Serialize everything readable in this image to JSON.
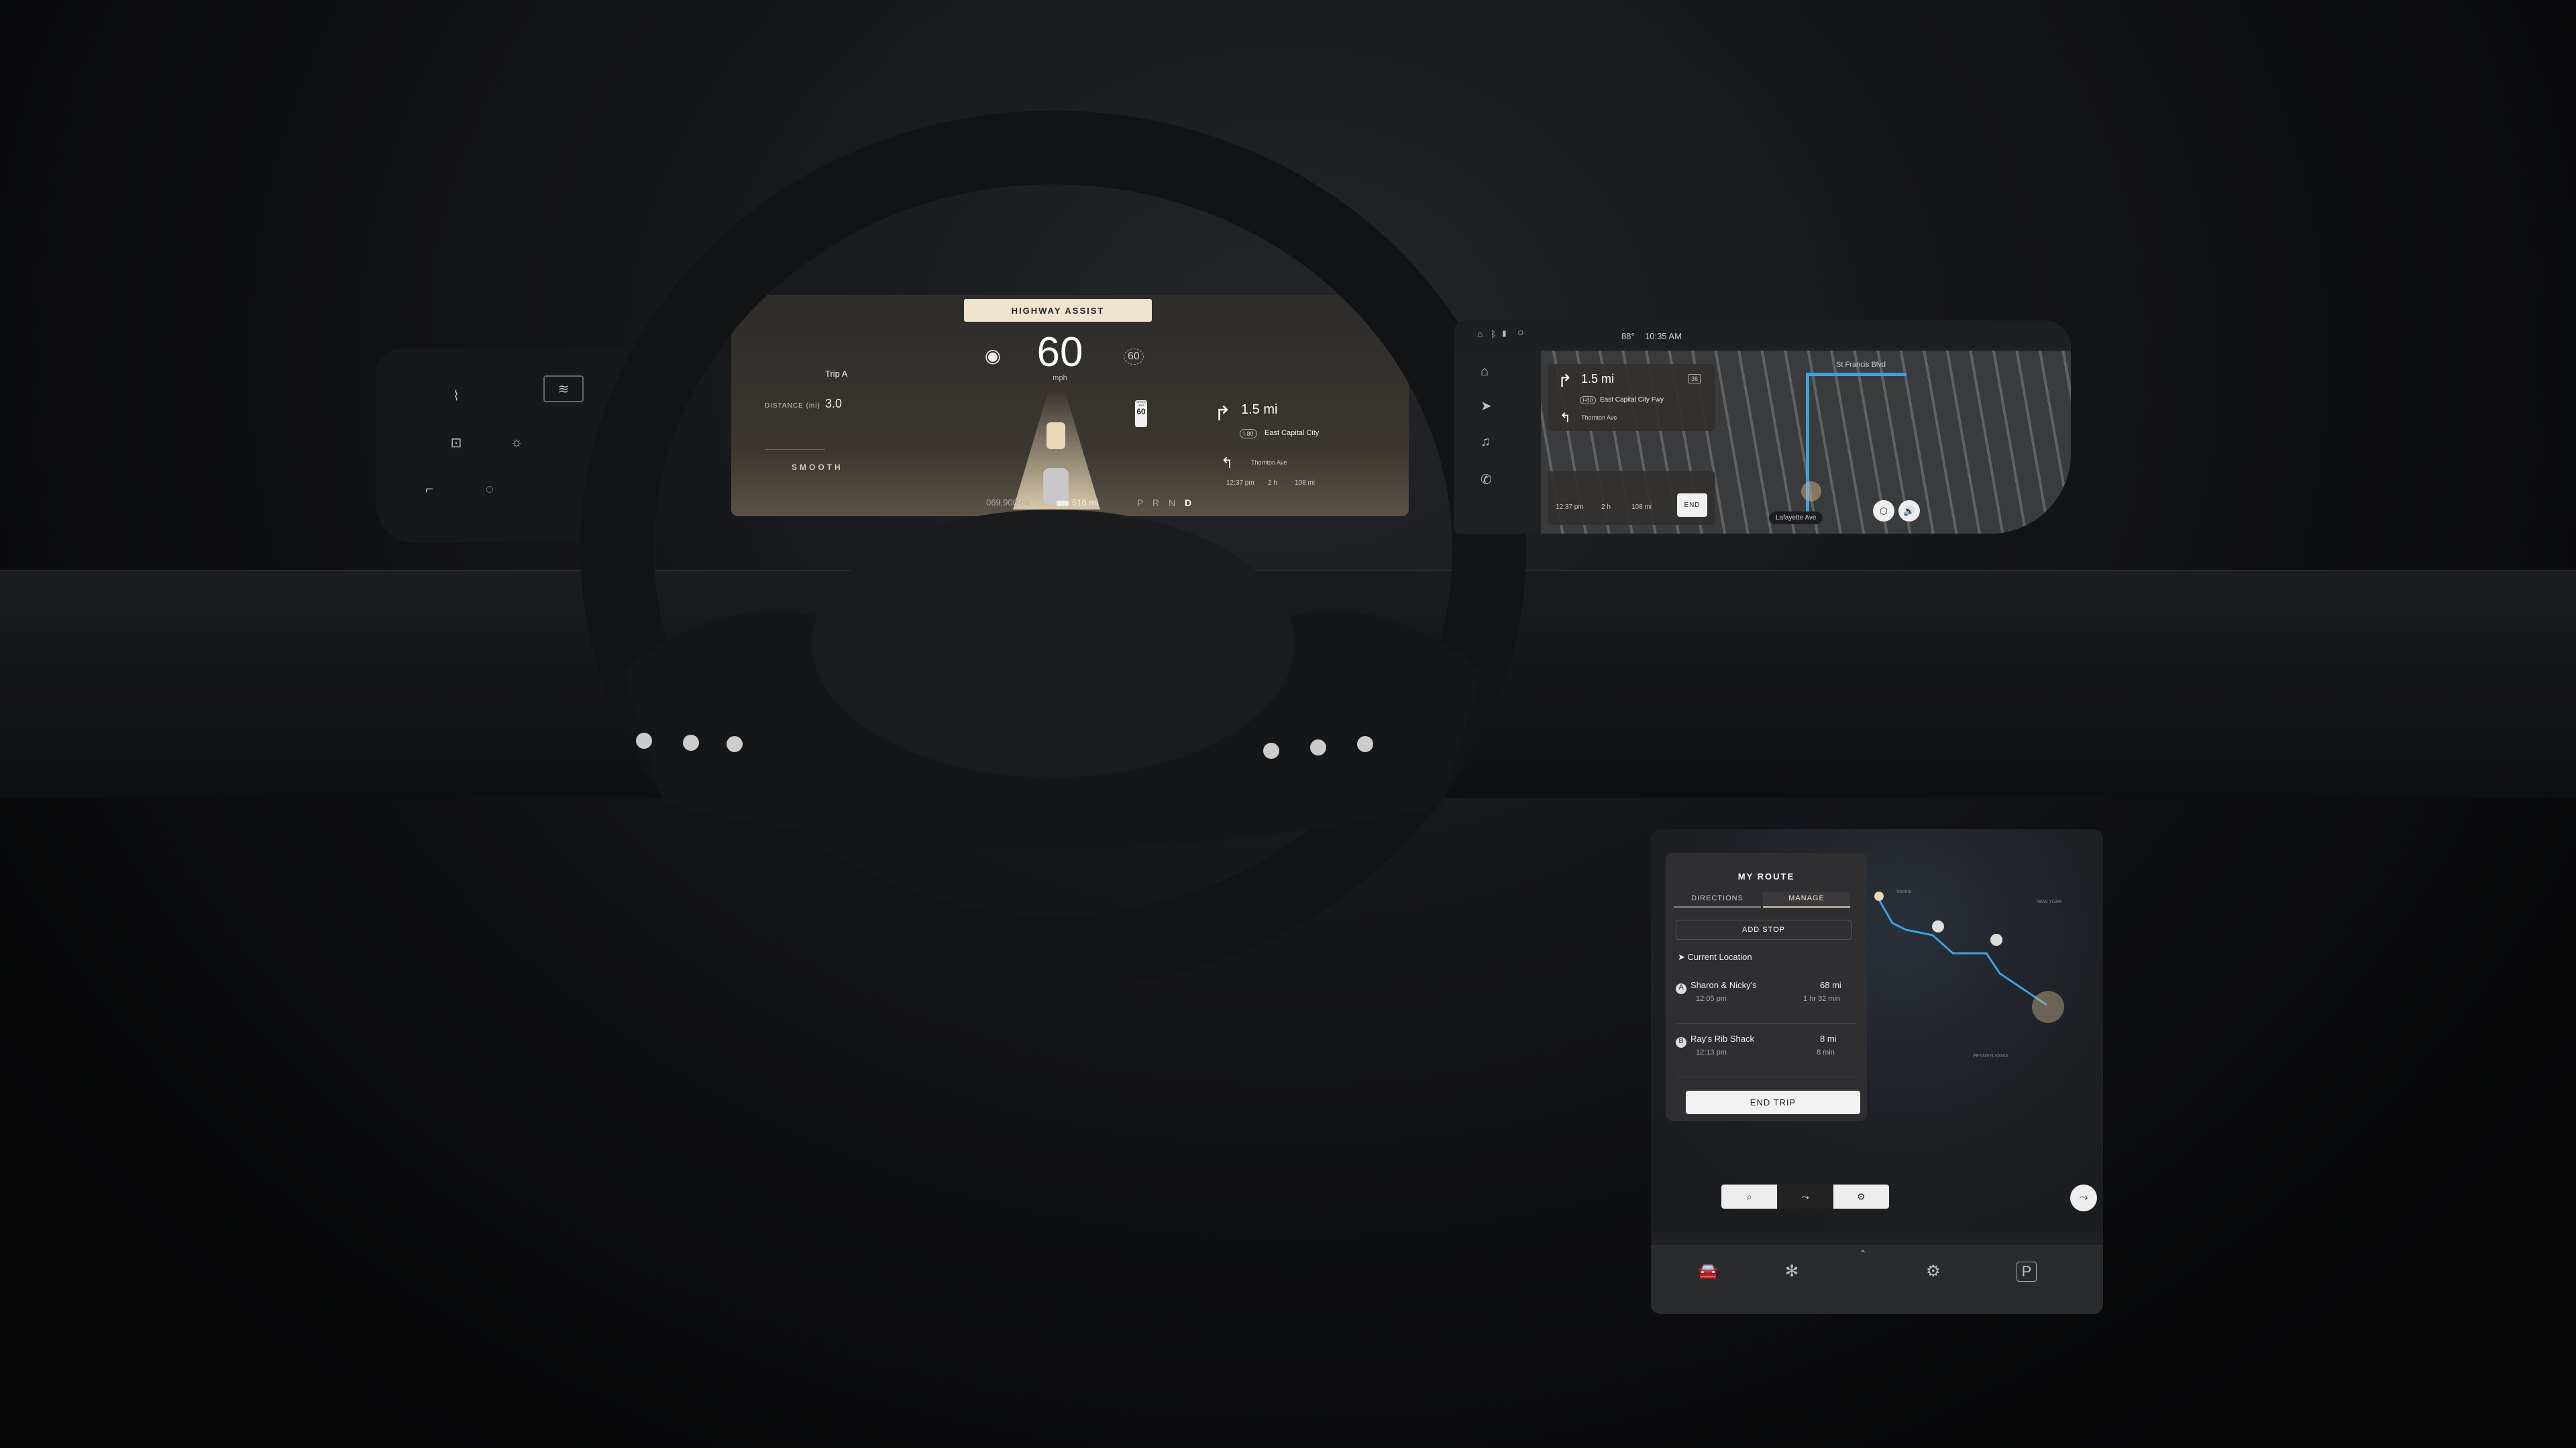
{
  "cluster": {
    "mode_banner": "HIGHWAY ASSIST",
    "speed": "60",
    "speed_unit": "mph",
    "set_speed": "60",
    "trip_label": "Trip A",
    "distance_label": "DISTANCE (mi)",
    "distance_value": "3.0",
    "drive_mode": "SMOOTH",
    "speed_limit_label": "SPEED LIMIT",
    "speed_limit": "60",
    "odometer": "069,900 mi",
    "range": "516 mi",
    "gears": "P R N",
    "gear_active": "D",
    "nav": {
      "distance": "1.5 mi",
      "highway": "I-80",
      "road": "East Capital City",
      "next_road": "Thornton Ave",
      "eta": "12:37 pm",
      "duration": "2 h",
      "remaining": "108 mi"
    }
  },
  "center": {
    "status": {
      "temperature": "88°",
      "time": "10:35 AM"
    },
    "nav": {
      "distance": "1.5 mi",
      "exit": "36",
      "highway": "I-80",
      "road": "East Capital City Fwy",
      "next_road": "Thornton Ave",
      "eta": "12:37 pm",
      "duration": "2 h",
      "remaining": "108 mi",
      "end_label": "END"
    },
    "street_labels": {
      "top": "St Francis Blvd",
      "current": "Lafayette Ave"
    },
    "route_color": "#3aa0e6"
  },
  "lower": {
    "title": "MY ROUTE",
    "tabs": [
      {
        "label": "DIRECTIONS",
        "active": false
      },
      {
        "label": "MANAGE",
        "active": true
      }
    ],
    "add_stop": "ADD STOP",
    "current_location": "Current Location",
    "stops": [
      {
        "marker": "A",
        "name": "Sharon & Nicky's",
        "time": "12:05 pm",
        "distance": "68 mi",
        "duration": "1 hr 32 min"
      },
      {
        "marker": "B",
        "name": "Ray's Rib Shack",
        "time": "12:13 pm",
        "distance": "8 mi",
        "duration": "8 min"
      }
    ],
    "end_trip": "END TRIP",
    "map_labels": [
      "NEW YORK",
      "PENNSYLVANIA",
      "Toronto"
    ]
  }
}
